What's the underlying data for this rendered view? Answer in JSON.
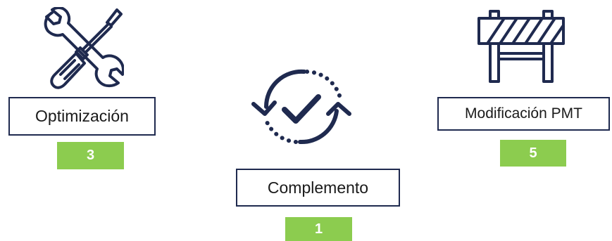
{
  "items": [
    {
      "icon": "wrench-screwdriver-icon",
      "label": "Optimización",
      "count": "3"
    },
    {
      "icon": "cycle-check-icon",
      "label": "Complemento",
      "count": "1"
    },
    {
      "icon": "road-barrier-icon",
      "label": "Modificación PMT",
      "count": "5"
    }
  ],
  "colors": {
    "navy": "#1f2a4f",
    "badge_green": "#8ccc4f",
    "badge_text": "#ffffff"
  }
}
